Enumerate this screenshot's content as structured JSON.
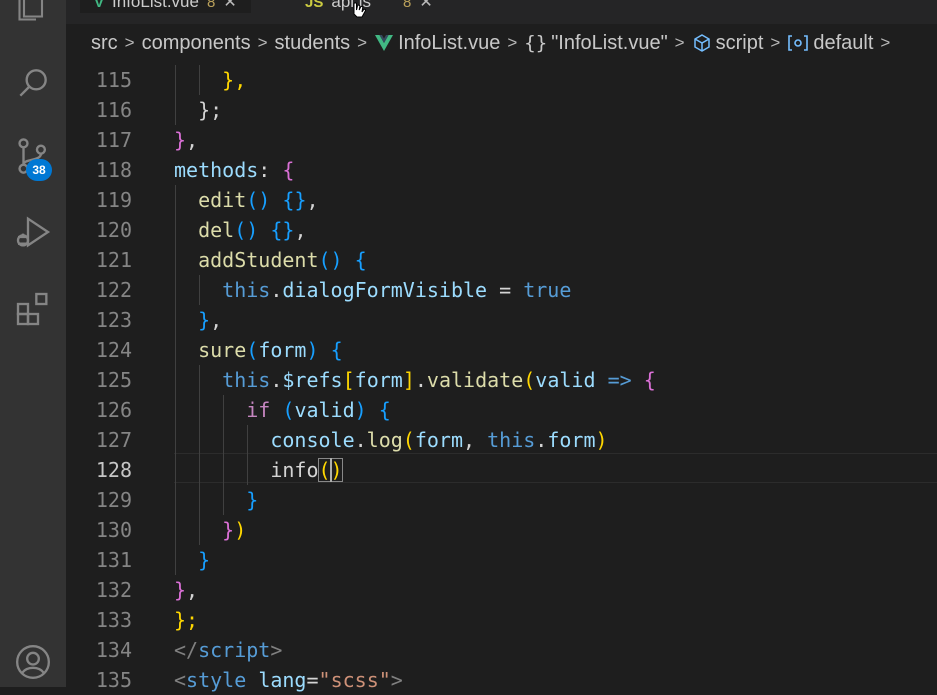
{
  "tabs": [
    {
      "name": "InfoList.vue",
      "icon": "V",
      "icon_color": "#41b883",
      "modified": "8",
      "active": true
    },
    {
      "name": "api.js",
      "icon": "JS",
      "icon_color": "#cbcb41",
      "modified": "8",
      "active": false
    }
  ],
  "activity_bar": {
    "items": [
      {
        "name": "explorer-icon"
      },
      {
        "name": "search-icon"
      },
      {
        "name": "source-control-icon",
        "badge": "38"
      },
      {
        "name": "run-debug-icon"
      },
      {
        "name": "extensions-icon"
      },
      {
        "name": "accounts-icon"
      }
    ],
    "badge_color": "#0078d4"
  },
  "breadcrumb": {
    "items": [
      "src",
      "components",
      "students",
      "InfoList.vue",
      "\"InfoList.vue\"",
      "script",
      "default"
    ],
    "icons": {
      "vue": "#41b883",
      "braces": "#c8c8c8",
      "cube": "#75beff",
      "object": "#75beff"
    }
  },
  "editor": {
    "current_line": 128,
    "lines": [
      {
        "num": "115",
        "tokens": [
          [
            "    ",
            "#d4d4d4"
          ],
          [
            "},",
            "#ffd700"
          ]
        ]
      },
      {
        "num": "116",
        "tokens": [
          [
            "  ",
            "#d4d4d4"
          ],
          [
            "};",
            "#d4d4d4"
          ]
        ]
      },
      {
        "num": "117",
        "tokens": [
          [
            "}",
            "#da70d6"
          ],
          [
            ",",
            "#d4d4d4"
          ]
        ]
      },
      {
        "num": "118",
        "tokens": [
          [
            "methods",
            "#9cdcfe"
          ],
          [
            ": ",
            "#d4d4d4"
          ],
          [
            "{",
            "#da70d6"
          ]
        ]
      },
      {
        "num": "119",
        "tokens": [
          [
            "  ",
            "#d4d4d4"
          ],
          [
            "edit",
            "#dcdcaa"
          ],
          [
            "()",
            "#179fff"
          ],
          [
            " ",
            "#d4d4d4"
          ],
          [
            "{}",
            "#179fff"
          ],
          [
            ",",
            "#d4d4d4"
          ]
        ]
      },
      {
        "num": "120",
        "tokens": [
          [
            "  ",
            "#d4d4d4"
          ],
          [
            "del",
            "#dcdcaa"
          ],
          [
            "()",
            "#179fff"
          ],
          [
            " ",
            "#d4d4d4"
          ],
          [
            "{}",
            "#179fff"
          ],
          [
            ",",
            "#d4d4d4"
          ]
        ]
      },
      {
        "num": "121",
        "tokens": [
          [
            "  ",
            "#d4d4d4"
          ],
          [
            "addStudent",
            "#dcdcaa"
          ],
          [
            "()",
            "#179fff"
          ],
          [
            " ",
            "#d4d4d4"
          ],
          [
            "{",
            "#179fff"
          ]
        ]
      },
      {
        "num": "122",
        "tokens": [
          [
            "    ",
            "#d4d4d4"
          ],
          [
            "this",
            "#569cd6"
          ],
          [
            ".",
            "#d4d4d4"
          ],
          [
            "dialogFormVisible",
            "#9cdcfe"
          ],
          [
            " = ",
            "#d4d4d4"
          ],
          [
            "true",
            "#569cd6"
          ]
        ]
      },
      {
        "num": "123",
        "tokens": [
          [
            "  ",
            "#d4d4d4"
          ],
          [
            "}",
            "#179fff"
          ],
          [
            ",",
            "#d4d4d4"
          ]
        ]
      },
      {
        "num": "124",
        "tokens": [
          [
            "  ",
            "#d4d4d4"
          ],
          [
            "sure",
            "#dcdcaa"
          ],
          [
            "(",
            "#179fff"
          ],
          [
            "form",
            "#9cdcfe"
          ],
          [
            ")",
            "#179fff"
          ],
          [
            " ",
            "#d4d4d4"
          ],
          [
            "{",
            "#179fff"
          ]
        ]
      },
      {
        "num": "125",
        "tokens": [
          [
            "    ",
            "#d4d4d4"
          ],
          [
            "this",
            "#569cd6"
          ],
          [
            ".",
            "#d4d4d4"
          ],
          [
            "$refs",
            "#9cdcfe"
          ],
          [
            "[",
            "#ffd700"
          ],
          [
            "form",
            "#9cdcfe"
          ],
          [
            "]",
            "#ffd700"
          ],
          [
            ".",
            "#d4d4d4"
          ],
          [
            "validate",
            "#dcdcaa"
          ],
          [
            "(",
            "#ffd700"
          ],
          [
            "valid",
            "#9cdcfe"
          ],
          [
            " ",
            "#d4d4d4"
          ],
          [
            "=>",
            "#569cd6"
          ],
          [
            " ",
            "#d4d4d4"
          ],
          [
            "{",
            "#da70d6"
          ]
        ]
      },
      {
        "num": "126",
        "tokens": [
          [
            "      ",
            "#d4d4d4"
          ],
          [
            "if",
            "#c586c0"
          ],
          [
            " ",
            "#d4d4d4"
          ],
          [
            "(",
            "#179fff"
          ],
          [
            "valid",
            "#9cdcfe"
          ],
          [
            ")",
            "#179fff"
          ],
          [
            " ",
            "#d4d4d4"
          ],
          [
            "{",
            "#179fff"
          ]
        ]
      },
      {
        "num": "127",
        "tokens": [
          [
            "        ",
            "#d4d4d4"
          ],
          [
            "console",
            "#9cdcfe"
          ],
          [
            ".",
            "#d4d4d4"
          ],
          [
            "log",
            "#dcdcaa"
          ],
          [
            "(",
            "#ffd700"
          ],
          [
            "form",
            "#9cdcfe"
          ],
          [
            ", ",
            "#d4d4d4"
          ],
          [
            "this",
            "#569cd6"
          ],
          [
            ".",
            "#d4d4d4"
          ],
          [
            "form",
            "#9cdcfe"
          ],
          [
            ")",
            "#ffd700"
          ]
        ]
      },
      {
        "num": "128",
        "tokens": [
          [
            "        ",
            "#d4d4d4"
          ],
          [
            "info",
            "#d4d4d4"
          ],
          [
            "(",
            "#ffd700"
          ],
          [
            ")",
            "#ffd700"
          ]
        ]
      },
      {
        "num": "129",
        "tokens": [
          [
            "      ",
            "#d4d4d4"
          ],
          [
            "}",
            "#179fff"
          ]
        ]
      },
      {
        "num": "130",
        "tokens": [
          [
            "    ",
            "#d4d4d4"
          ],
          [
            "}",
            "#da70d6"
          ],
          [
            ")",
            "#ffd700"
          ]
        ]
      },
      {
        "num": "131",
        "tokens": [
          [
            "  ",
            "#d4d4d4"
          ],
          [
            "}",
            "#179fff"
          ]
        ]
      },
      {
        "num": "132",
        "tokens": [
          [
            "}",
            "#da70d6"
          ],
          [
            ",",
            "#d4d4d4"
          ]
        ]
      },
      {
        "num": "133",
        "tokens": [
          [
            "};",
            "#ffd700"
          ]
        ]
      },
      {
        "num": "134",
        "tokens": [
          [
            "</",
            "#808080"
          ],
          [
            "script",
            "#569cd6"
          ],
          [
            ">",
            "#808080"
          ]
        ]
      },
      {
        "num": "135",
        "tokens": [
          [
            "<",
            "#808080"
          ],
          [
            "style",
            "#569cd6"
          ],
          [
            " ",
            "#d4d4d4"
          ],
          [
            "lang",
            "#9cdcfe"
          ],
          [
            "=",
            "#d4d4d4"
          ],
          [
            "\"scss\"",
            "#ce9178"
          ],
          [
            ">",
            "#808080"
          ]
        ]
      }
    ]
  }
}
